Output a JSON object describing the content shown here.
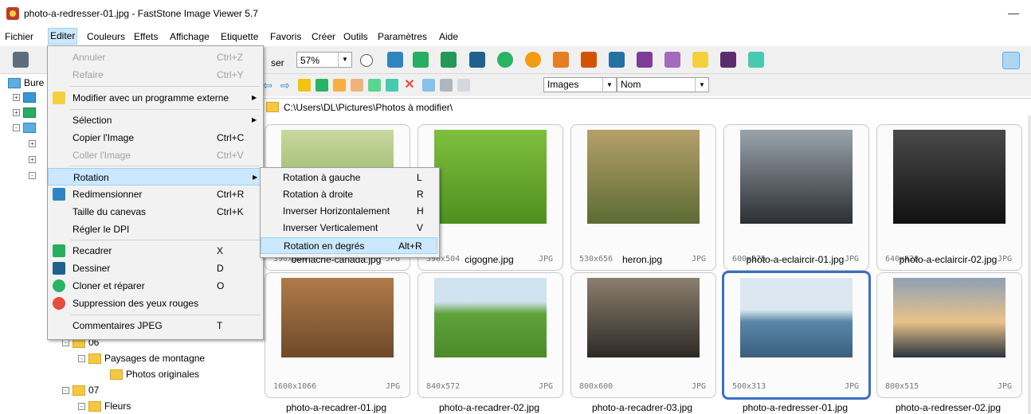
{
  "window": {
    "title": "photo-a-redresser-01.jpg  -  FastStone Image Viewer 5.7",
    "minimize_glyph": "—"
  },
  "menubar": [
    "Fichier",
    "Editer",
    "Couleurs",
    "Effets",
    "Affichage",
    "Etiquette",
    "Favoris",
    "Créer",
    "Outils",
    "Paramètres",
    "Aide"
  ],
  "toolbar": {
    "label_fragment": "ser",
    "zoom": "57%"
  },
  "sort_bar": {
    "filter": "Images",
    "sort": "Nom"
  },
  "path": "C:\\Users\\DL\\Pictures\\Photos à modifier\\",
  "tree": {
    "root": "Bure",
    "items": [
      "06",
      "Paysages de montagne",
      "Photos originales",
      "07",
      "Fleurs"
    ]
  },
  "edit_menu": [
    {
      "label": "Annuler",
      "shortcut": "Ctrl+Z",
      "disabled": true
    },
    {
      "label": "Refaire",
      "shortcut": "Ctrl+Y",
      "disabled": true
    },
    {
      "label": "Modifier avec un programme externe",
      "shortcut": "",
      "submenu": true
    },
    {
      "label": "Sélection",
      "shortcut": "",
      "submenu": true
    },
    {
      "label": "Copier l'Image",
      "shortcut": "Ctrl+C"
    },
    {
      "label": "Coller l'Image",
      "shortcut": "Ctrl+V",
      "disabled": true
    },
    {
      "label": "Rotation",
      "shortcut": "",
      "submenu": true,
      "highlighted": true
    },
    {
      "label": "Redimensionner",
      "shortcut": "Ctrl+R"
    },
    {
      "label": "Taille du canevas",
      "shortcut": "Ctrl+K"
    },
    {
      "label": "Régler le DPI",
      "shortcut": ""
    },
    {
      "label": "Recadrer",
      "shortcut": "X"
    },
    {
      "label": "Dessiner",
      "shortcut": "D"
    },
    {
      "label": "Cloner et réparer",
      "shortcut": "O"
    },
    {
      "label": "Suppression des yeux rouges",
      "shortcut": ""
    },
    {
      "label": "Commentaires JPEG",
      "shortcut": "T"
    }
  ],
  "rotation_submenu": [
    {
      "label": "Rotation à gauche",
      "shortcut": "L"
    },
    {
      "label": "Rotation à droite",
      "shortcut": "R"
    },
    {
      "label": "Inverser Horizontalement",
      "shortcut": "H"
    },
    {
      "label": "Inverser Verticalement",
      "shortcut": "V"
    },
    {
      "label": "Rotation en degrés",
      "shortcut": "Alt+R",
      "highlighted": true
    }
  ],
  "thumbnails": [
    {
      "name": "bernache-canada.jpg",
      "dims": "390x504",
      "format": "JPG"
    },
    {
      "name": "cigogne.jpg",
      "dims": "390x504",
      "format": "JPG"
    },
    {
      "name": "heron.jpg",
      "dims": "530x656",
      "format": "JPG"
    },
    {
      "name": "photo-a-eclaircir-01.jpg",
      "dims": "600x375",
      "format": "JPG"
    },
    {
      "name": "photo-a-eclaircir-02.jpg",
      "dims": "640x428",
      "format": "JPG"
    },
    {
      "name": "photo-a-recadrer-01.jpg",
      "dims": "1600x1066",
      "format": "JPG"
    },
    {
      "name": "photo-a-recadrer-02.jpg",
      "dims": "840x572",
      "format": "JPG"
    },
    {
      "name": "photo-a-recadrer-03.jpg",
      "dims": "800x600",
      "format": "JPG"
    },
    {
      "name": "photo-a-redresser-01.jpg",
      "dims": "500x313",
      "format": "JPG",
      "selected": true
    },
    {
      "name": "photo-a-redresser-02.jpg",
      "dims": "800x515",
      "format": "JPG"
    }
  ]
}
